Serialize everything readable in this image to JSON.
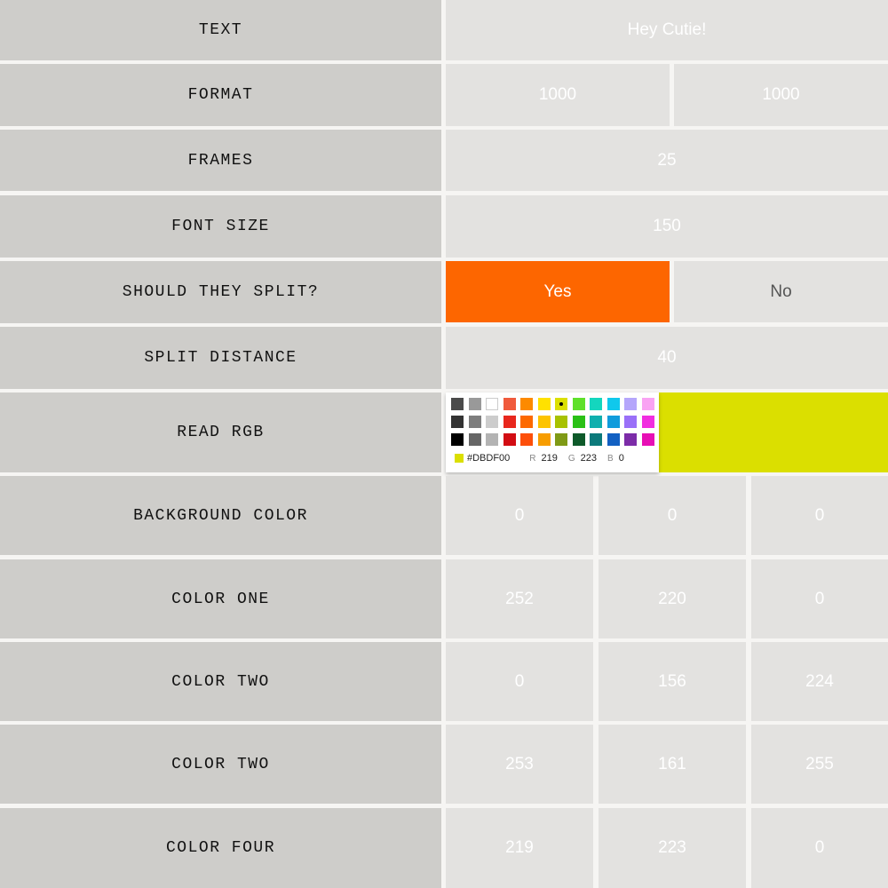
{
  "rows": {
    "text": {
      "label": "TEXT",
      "value": "Hey Cutie!"
    },
    "format": {
      "label": "FORMAT",
      "width": "1000",
      "height": "1000"
    },
    "frames": {
      "label": "FRAMES",
      "value": "25"
    },
    "font_size": {
      "label": "FONT SIZE",
      "value": "150"
    },
    "split": {
      "label": "SHOULD THEY SPLIT?",
      "yes": "Yes",
      "no": "No",
      "selected": "Yes"
    },
    "split_distance": {
      "label": "SPLIT DISTANCE",
      "value": "40"
    },
    "read_rgb": {
      "label": "READ RGB",
      "color": "#DBDF00"
    },
    "background_color": {
      "label": "BACKGROUND COLOR",
      "r": "0",
      "g": "0",
      "b": "0"
    },
    "color_one": {
      "label": "COLOR ONE",
      "r": "252",
      "g": "220",
      "b": "0"
    },
    "color_two": {
      "label": "COLOR TWO",
      "r": "0",
      "g": "156",
      "b": "224"
    },
    "color_two_b": {
      "label": "COLOR TWO",
      "r": "253",
      "g": "161",
      "b": "255"
    },
    "color_four": {
      "label": "COLOR FOUR",
      "r": "219",
      "g": "223",
      "b": "0"
    }
  },
  "picker": {
    "hex": "#DBDF00",
    "r_label": "R",
    "r": "219",
    "g_label": "G",
    "g": "223",
    "b_label": "B",
    "b": "0",
    "selected_index": 6,
    "swatches": [
      "#4a4a4a",
      "#999999",
      "#ffffff",
      "#f05a3c",
      "#fd8a00",
      "#ffe100",
      "#dbdf00",
      "#5fe02a",
      "#14d6be",
      "#10c8ec",
      "#b5a6fb",
      "#f9a3f3",
      "#333333",
      "#7d7d7d",
      "#cccccc",
      "#e8271d",
      "#fd6a00",
      "#fdc400",
      "#a8c200",
      "#2ac116",
      "#10afae",
      "#109cdc",
      "#9a70f8",
      "#f12ee0",
      "#000000",
      "#666666",
      "#b3b3b3",
      "#d20d13",
      "#fd4f0a",
      "#f79d00",
      "#7f9a16",
      "#0e5a2a",
      "#0c7a7b",
      "#1260c2",
      "#7c2ca8",
      "#e70fb5"
    ]
  },
  "colors": {
    "label_bg": "#cecdca",
    "cell_bg": "#e3e2e0",
    "accent": "#fd6600",
    "page_bg": "#f6f5f3"
  }
}
